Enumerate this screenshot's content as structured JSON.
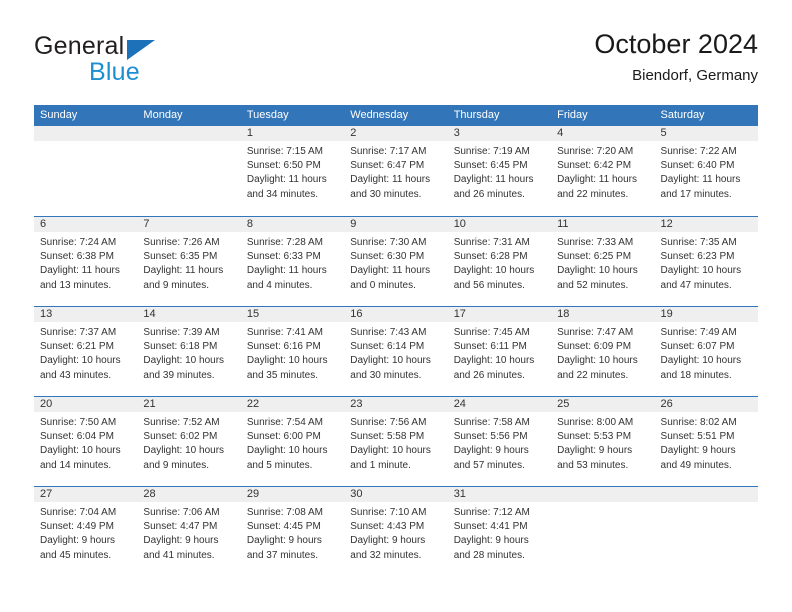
{
  "brand": {
    "name_top": "General",
    "name_bottom": "Blue",
    "triangle_color": "#1d71b8",
    "blue_text_color": "#1d8fd1"
  },
  "header": {
    "month_title": "October 2024",
    "location": "Biendorf, Germany",
    "accent_color": "#3275b8",
    "band_color": "#efefef"
  },
  "weekdays": [
    "Sunday",
    "Monday",
    "Tuesday",
    "Wednesday",
    "Thursday",
    "Friday",
    "Saturday"
  ],
  "weeks": [
    [
      {
        "day": "",
        "lines": []
      },
      {
        "day": "",
        "lines": []
      },
      {
        "day": "1",
        "lines": [
          "Sunrise: 7:15 AM",
          "Sunset: 6:50 PM",
          "Daylight: 11 hours",
          "and 34 minutes."
        ]
      },
      {
        "day": "2",
        "lines": [
          "Sunrise: 7:17 AM",
          "Sunset: 6:47 PM",
          "Daylight: 11 hours",
          "and 30 minutes."
        ]
      },
      {
        "day": "3",
        "lines": [
          "Sunrise: 7:19 AM",
          "Sunset: 6:45 PM",
          "Daylight: 11 hours",
          "and 26 minutes."
        ]
      },
      {
        "day": "4",
        "lines": [
          "Sunrise: 7:20 AM",
          "Sunset: 6:42 PM",
          "Daylight: 11 hours",
          "and 22 minutes."
        ]
      },
      {
        "day": "5",
        "lines": [
          "Sunrise: 7:22 AM",
          "Sunset: 6:40 PM",
          "Daylight: 11 hours",
          "and 17 minutes."
        ]
      }
    ],
    [
      {
        "day": "6",
        "lines": [
          "Sunrise: 7:24 AM",
          "Sunset: 6:38 PM",
          "Daylight: 11 hours",
          "and 13 minutes."
        ]
      },
      {
        "day": "7",
        "lines": [
          "Sunrise: 7:26 AM",
          "Sunset: 6:35 PM",
          "Daylight: 11 hours",
          "and 9 minutes."
        ]
      },
      {
        "day": "8",
        "lines": [
          "Sunrise: 7:28 AM",
          "Sunset: 6:33 PM",
          "Daylight: 11 hours",
          "and 4 minutes."
        ]
      },
      {
        "day": "9",
        "lines": [
          "Sunrise: 7:30 AM",
          "Sunset: 6:30 PM",
          "Daylight: 11 hours",
          "and 0 minutes."
        ]
      },
      {
        "day": "10",
        "lines": [
          "Sunrise: 7:31 AM",
          "Sunset: 6:28 PM",
          "Daylight: 10 hours",
          "and 56 minutes."
        ]
      },
      {
        "day": "11",
        "lines": [
          "Sunrise: 7:33 AM",
          "Sunset: 6:25 PM",
          "Daylight: 10 hours",
          "and 52 minutes."
        ]
      },
      {
        "day": "12",
        "lines": [
          "Sunrise: 7:35 AM",
          "Sunset: 6:23 PM",
          "Daylight: 10 hours",
          "and 47 minutes."
        ]
      }
    ],
    [
      {
        "day": "13",
        "lines": [
          "Sunrise: 7:37 AM",
          "Sunset: 6:21 PM",
          "Daylight: 10 hours",
          "and 43 minutes."
        ]
      },
      {
        "day": "14",
        "lines": [
          "Sunrise: 7:39 AM",
          "Sunset: 6:18 PM",
          "Daylight: 10 hours",
          "and 39 minutes."
        ]
      },
      {
        "day": "15",
        "lines": [
          "Sunrise: 7:41 AM",
          "Sunset: 6:16 PM",
          "Daylight: 10 hours",
          "and 35 minutes."
        ]
      },
      {
        "day": "16",
        "lines": [
          "Sunrise: 7:43 AM",
          "Sunset: 6:14 PM",
          "Daylight: 10 hours",
          "and 30 minutes."
        ]
      },
      {
        "day": "17",
        "lines": [
          "Sunrise: 7:45 AM",
          "Sunset: 6:11 PM",
          "Daylight: 10 hours",
          "and 26 minutes."
        ]
      },
      {
        "day": "18",
        "lines": [
          "Sunrise: 7:47 AM",
          "Sunset: 6:09 PM",
          "Daylight: 10 hours",
          "and 22 minutes."
        ]
      },
      {
        "day": "19",
        "lines": [
          "Sunrise: 7:49 AM",
          "Sunset: 6:07 PM",
          "Daylight: 10 hours",
          "and 18 minutes."
        ]
      }
    ],
    [
      {
        "day": "20",
        "lines": [
          "Sunrise: 7:50 AM",
          "Sunset: 6:04 PM",
          "Daylight: 10 hours",
          "and 14 minutes."
        ]
      },
      {
        "day": "21",
        "lines": [
          "Sunrise: 7:52 AM",
          "Sunset: 6:02 PM",
          "Daylight: 10 hours",
          "and 9 minutes."
        ]
      },
      {
        "day": "22",
        "lines": [
          "Sunrise: 7:54 AM",
          "Sunset: 6:00 PM",
          "Daylight: 10 hours",
          "and 5 minutes."
        ]
      },
      {
        "day": "23",
        "lines": [
          "Sunrise: 7:56 AM",
          "Sunset: 5:58 PM",
          "Daylight: 10 hours",
          "and 1 minute."
        ]
      },
      {
        "day": "24",
        "lines": [
          "Sunrise: 7:58 AM",
          "Sunset: 5:56 PM",
          "Daylight: 9 hours",
          "and 57 minutes."
        ]
      },
      {
        "day": "25",
        "lines": [
          "Sunrise: 8:00 AM",
          "Sunset: 5:53 PM",
          "Daylight: 9 hours",
          "and 53 minutes."
        ]
      },
      {
        "day": "26",
        "lines": [
          "Sunrise: 8:02 AM",
          "Sunset: 5:51 PM",
          "Daylight: 9 hours",
          "and 49 minutes."
        ]
      }
    ],
    [
      {
        "day": "27",
        "lines": [
          "Sunrise: 7:04 AM",
          "Sunset: 4:49 PM",
          "Daylight: 9 hours",
          "and 45 minutes."
        ]
      },
      {
        "day": "28",
        "lines": [
          "Sunrise: 7:06 AM",
          "Sunset: 4:47 PM",
          "Daylight: 9 hours",
          "and 41 minutes."
        ]
      },
      {
        "day": "29",
        "lines": [
          "Sunrise: 7:08 AM",
          "Sunset: 4:45 PM",
          "Daylight: 9 hours",
          "and 37 minutes."
        ]
      },
      {
        "day": "30",
        "lines": [
          "Sunrise: 7:10 AM",
          "Sunset: 4:43 PM",
          "Daylight: 9 hours",
          "and 32 minutes."
        ]
      },
      {
        "day": "31",
        "lines": [
          "Sunrise: 7:12 AM",
          "Sunset: 4:41 PM",
          "Daylight: 9 hours",
          "and 28 minutes."
        ]
      },
      {
        "day": "",
        "lines": []
      },
      {
        "day": "",
        "lines": []
      }
    ]
  ]
}
